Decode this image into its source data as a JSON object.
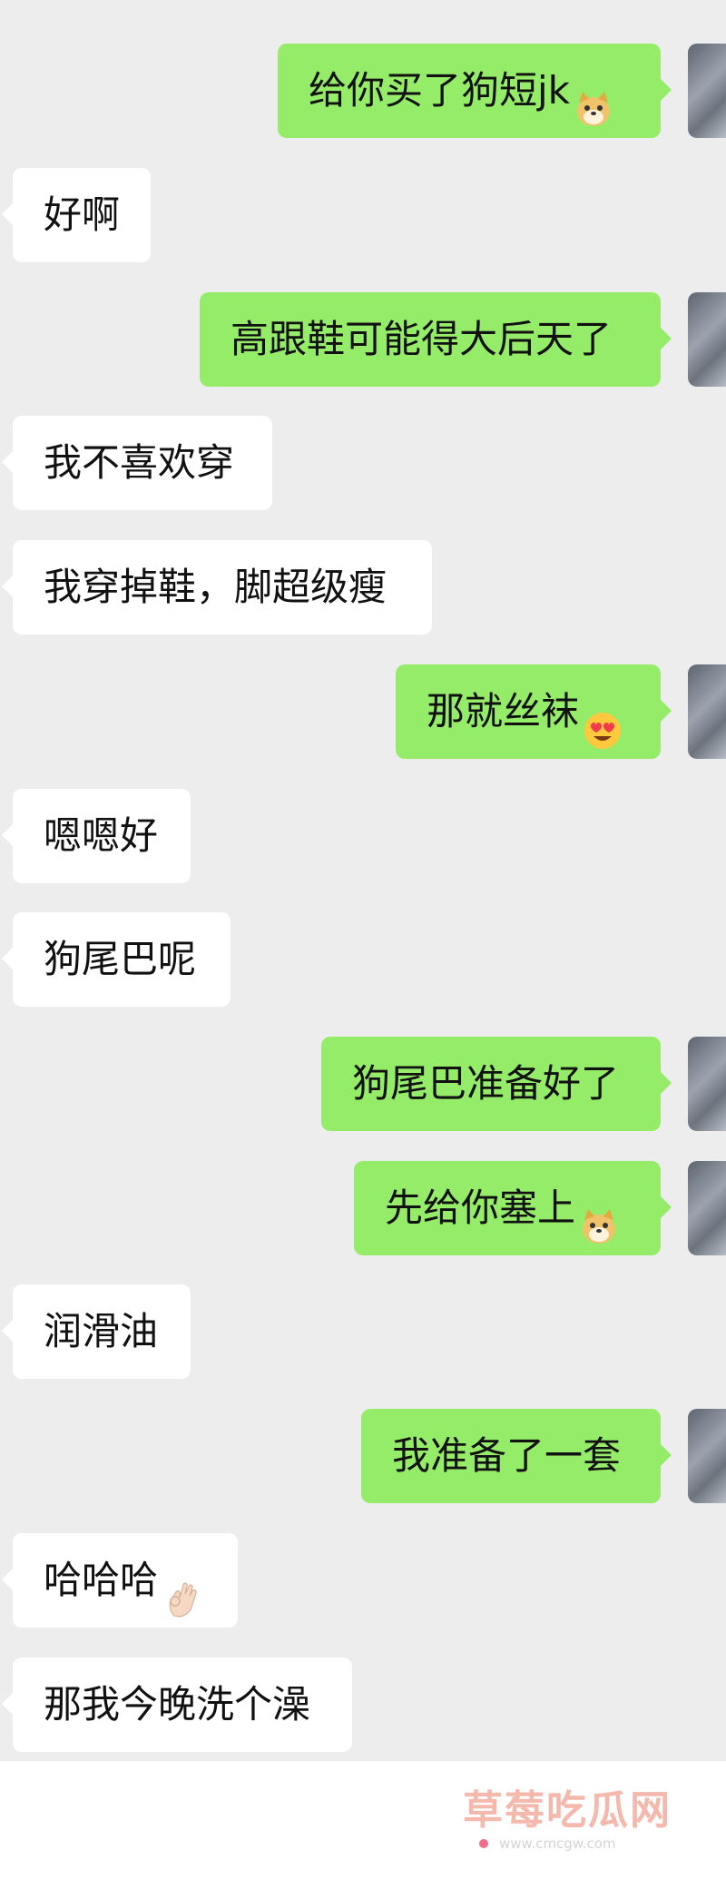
{
  "messages": [
    {
      "side": "out",
      "text": "给你买了狗短jk",
      "emoji": "doge-emoji"
    },
    {
      "side": "in",
      "text": "好啊"
    },
    {
      "side": "out",
      "text": "高跟鞋可能得大后天了"
    },
    {
      "side": "in",
      "text": "我不喜欢穿"
    },
    {
      "side": "in",
      "text": "我穿掉鞋，脚超级瘦"
    },
    {
      "side": "out",
      "text": "那就丝袜",
      "emoji": "heart-eyes-emoji"
    },
    {
      "side": "in",
      "text": "嗯嗯好"
    },
    {
      "side": "in",
      "text": "狗尾巴呢"
    },
    {
      "side": "out",
      "text": "狗尾巴准备好了"
    },
    {
      "side": "out",
      "text": "先给你塞上",
      "emoji": "doge-emoji"
    },
    {
      "side": "in",
      "text": "润滑油"
    },
    {
      "side": "out",
      "text": "我准备了一套"
    },
    {
      "side": "in",
      "text": "哈哈哈",
      "emoji": "ok-hand-emoji"
    },
    {
      "side": "in",
      "text": "那我今晚洗个澡"
    }
  ],
  "watermark": {
    "title": "草莓吃瓜网",
    "url": "www.cmcgw.com"
  },
  "colors": {
    "outgoing_bubble": "#95ec69",
    "incoming_bubble": "#ffffff",
    "chat_background": "#ededed"
  }
}
